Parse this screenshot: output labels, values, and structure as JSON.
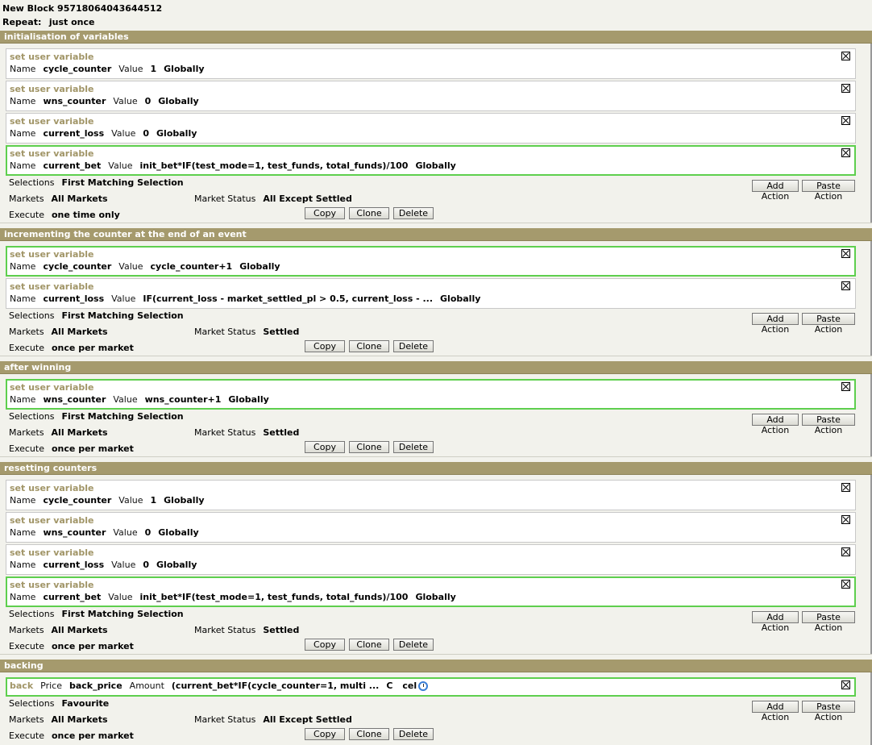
{
  "block": {
    "name": "New Block 95718064043644512",
    "repeat_label": "Repeat:",
    "repeat_value": "just once"
  },
  "labels": {
    "name": "Name",
    "value": "Value",
    "price": "Price",
    "amount": "Amount",
    "selections": "Selections",
    "markets": "Markets",
    "market_status": "Market Status",
    "execute": "Execute",
    "add_action": "Add Action",
    "paste_action": "Paste Action",
    "copy": "Copy",
    "clone": "Clone",
    "delete": "Delete"
  },
  "sections": [
    {
      "title": "initialisation of variables",
      "actions": [
        {
          "type": "set user variable",
          "name": "cycle_counter",
          "value": "1",
          "scope": "Globally"
        },
        {
          "type": "set user variable",
          "name": "wns_counter",
          "value": "0",
          "scope": "Globally"
        },
        {
          "type": "set user variable",
          "name": "current_loss",
          "value": "0",
          "scope": "Globally"
        },
        {
          "type": "set user variable",
          "name": "current_bet",
          "value": "init_bet*IF(test_mode=1, test_funds, total_funds)/100",
          "scope": "Globally"
        }
      ],
      "selections": "First Matching Selection",
      "markets": "All Markets",
      "market_status": "All Except Settled",
      "execute": "one time only"
    },
    {
      "title": "incrementing the counter at the end of an event",
      "actions": [
        {
          "type": "set user variable",
          "name": "cycle_counter",
          "value": "cycle_counter+1",
          "scope": "Globally"
        },
        {
          "type": "set user variable",
          "name": "current_loss",
          "value": "IF(current_loss - market_settled_pl > 0.5, current_loss - ...",
          "scope": "Globally"
        }
      ],
      "selections": "First Matching Selection",
      "markets": "All Markets",
      "market_status": "Settled",
      "execute": "once per market"
    },
    {
      "title": "after winning",
      "actions": [
        {
          "type": "set user variable",
          "name": "wns_counter",
          "value": "wns_counter+1",
          "scope": "Globally"
        }
      ],
      "selections": "First Matching Selection",
      "markets": "All Markets",
      "market_status": "Settled",
      "execute": "once per market"
    },
    {
      "title": "resetting counters",
      "actions": [
        {
          "type": "set user variable",
          "name": "cycle_counter",
          "value": "1",
          "scope": "Globally"
        },
        {
          "type": "set user variable",
          "name": "wns_counter",
          "value": "0",
          "scope": "Globally"
        },
        {
          "type": "set user variable",
          "name": "current_loss",
          "value": "0",
          "scope": "Globally"
        },
        {
          "type": "set user variable",
          "name": "current_bet",
          "value": "init_bet*IF(test_mode=1, test_funds, total_funds)/100",
          "scope": "Globally"
        }
      ],
      "selections": "First Matching Selection",
      "markets": "All Markets",
      "market_status": "Settled",
      "execute": "once per market"
    },
    {
      "title": "backing",
      "actions": [
        {
          "type": "back",
          "price": "back_price",
          "amount": "(current_bet*IF(cycle_counter=1, multi ...",
          "tail1": "C",
          "tail2": "cel",
          "icon": "clock-icon"
        }
      ],
      "selections": "Favourite",
      "markets": "All Markets",
      "market_status": "All Except Settled",
      "execute": "once per market"
    }
  ],
  "colors": {
    "section_header": "#a59a6d",
    "action_title": "#a19567",
    "selected_border": "#5ecf4e"
  }
}
